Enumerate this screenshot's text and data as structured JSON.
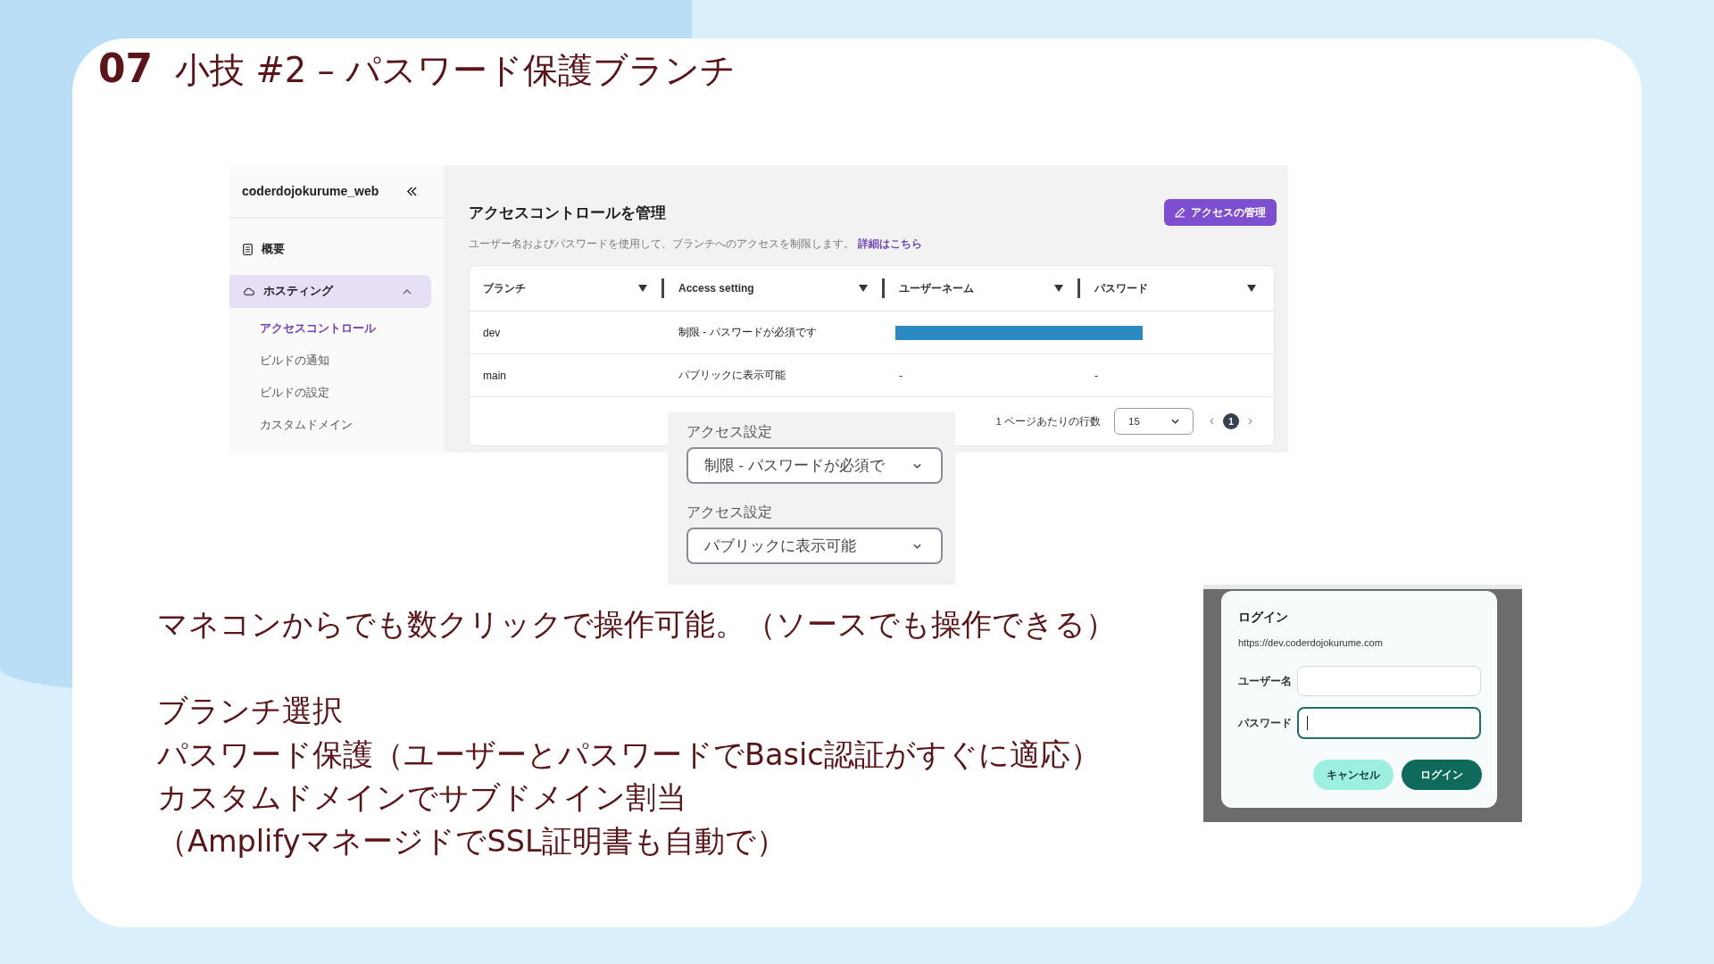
{
  "slide": {
    "number": "07",
    "title": "小技 #2 – パスワード保護ブランチ"
  },
  "console": {
    "sidebar": {
      "app_name": "coderdojokurume_web",
      "items": [
        {
          "kind": "page",
          "label": "概要",
          "selected": false
        },
        {
          "kind": "group",
          "label": "ホスティング",
          "selected": true,
          "expanded": true,
          "children": [
            {
              "label": "アクセスコントロール",
              "selected": true
            },
            {
              "label": "ビルドの通知",
              "selected": false
            },
            {
              "label": "ビルドの設定",
              "selected": false
            },
            {
              "label": "カスタムドメイン",
              "selected": false
            }
          ]
        }
      ]
    },
    "header": {
      "title": "アクセスコントロールを管理",
      "button": "アクセスの管理",
      "description": "ユーザー名およびパスワードを使用して、ブランチへのアクセスを制限します。",
      "link": "詳細はこちら"
    },
    "table": {
      "columns": [
        "ブランチ",
        "Access setting",
        "ユーザーネーム",
        "パスワード"
      ],
      "rows": [
        {
          "branch": "dev",
          "access_setting": "制限 - パスワードが必須です",
          "redacted": true
        },
        {
          "branch": "main",
          "access_setting": "パブリックに表示可能",
          "redacted": false,
          "username": "-",
          "password": "-"
        }
      ]
    },
    "pagination": {
      "rows_per_page_label": "1 ページあたりの行数",
      "rows_per_page": "15",
      "pages": [
        {
          "label": "1",
          "selected": true
        }
      ]
    }
  },
  "access_settings": [
    {
      "label": "アクセス設定",
      "value": "制限 - パスワードが必須で"
    },
    {
      "label": "アクセス設定",
      "value": "パブリックに表示可能"
    }
  ],
  "login_dialog": {
    "title": "ログイン",
    "url": "https://dev.coderdojokurume.com",
    "fields": [
      {
        "label": "ユーザー名",
        "focused": false
      },
      {
        "label": "パスワード",
        "focused": true
      }
    ],
    "buttons": [
      {
        "kind": "secondary",
        "label": "キャンセル"
      },
      {
        "kind": "primary",
        "label": "ログイン"
      }
    ]
  },
  "notes": {
    "intro": "マネコンからでも数クリックで操作可能。（ソースでも操作できる）",
    "points": [
      "ブランチ選択",
      "パスワード保護（ユーザーとパスワードでBasic認証がすぐに適応）",
      "カスタムドメインでサブドメイン割当",
      "（AmplifyマネージドでSSL証明書も自動で）"
    ]
  }
}
